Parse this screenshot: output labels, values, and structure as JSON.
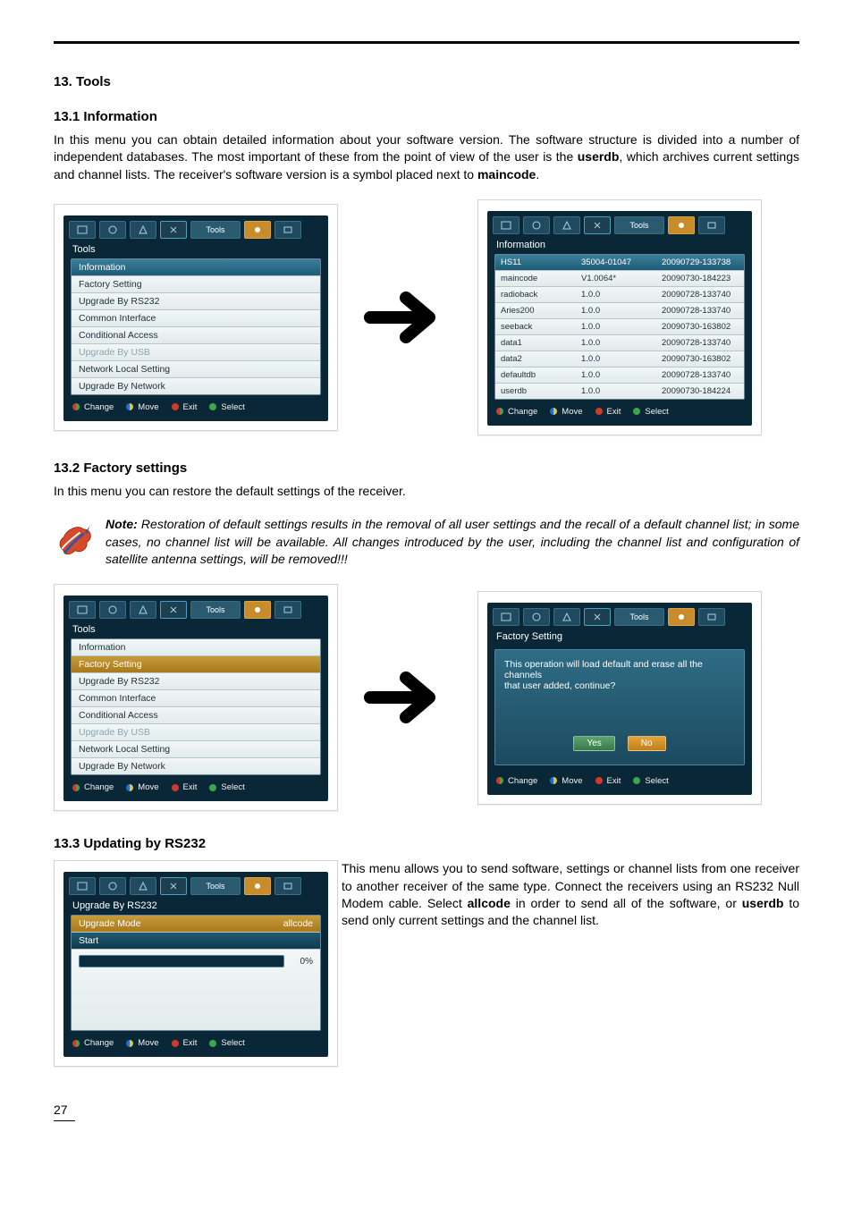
{
  "page_number": "27",
  "heading_tools": "13. Tools",
  "sec131": {
    "title": "13.1 Information",
    "para": "In this menu you can obtain detailed information about your software version. The software structure is divided into a number of independent databases. The most important of these from the point of view of the user is the ",
    "bold1": "userdb",
    "mid": ", which archives current settings and channel lists. The receiver's software version is a symbol placed next to ",
    "bold2": "maincode",
    "end": "."
  },
  "tools_menu_title": "Tools",
  "tabs_label": "Tools",
  "tools_items": [
    "Information",
    "Factory Setting",
    "Upgrade By RS232",
    "Common Interface",
    "Conditional Access",
    "Upgrade By USB",
    "Network Local Setting",
    "Upgrade By Network"
  ],
  "footer": {
    "change": "Change",
    "move": "Move",
    "exit": "Exit",
    "select": "Select"
  },
  "info_title": "Information",
  "info_rows": [
    {
      "k": "HS11",
      "v1": "35004-01047",
      "v2": "20090729-133738"
    },
    {
      "k": "maincode",
      "v1": "V1.0064*",
      "v2": "20090730-184223"
    },
    {
      "k": "radioback",
      "v1": "1.0.0",
      "v2": "20090728-133740"
    },
    {
      "k": "Aries200",
      "v1": "1.0.0",
      "v2": "20090728-133740"
    },
    {
      "k": "seeback",
      "v1": "1.0.0",
      "v2": "20090730-163802"
    },
    {
      "k": "data1",
      "v1": "1.0.0",
      "v2": "20090728-133740"
    },
    {
      "k": "data2",
      "v1": "1.0.0",
      "v2": "20090730-163802"
    },
    {
      "k": "defaultdb",
      "v1": "1.0.0",
      "v2": "20090728-133740"
    },
    {
      "k": "userdb",
      "v1": "1.0.0",
      "v2": "20090730-184224"
    }
  ],
  "sec132": {
    "title": "13.2 Factory settings",
    "para": "In this menu you can restore the default settings of the receiver.",
    "note_label": "Note:",
    "note": " Restoration of default settings results in the removal of all user settings and the recall of a default channel list; in some cases, no channel list will be available. All changes introduced by the user, including the channel list and configuration of satellite antenna settings, will be removed!!!"
  },
  "factory_title": "Factory Setting",
  "dialog": {
    "line1": "This operation will load default and erase all the channels",
    "line2": "that user added, continue?",
    "yes": "Yes",
    "no": "No"
  },
  "sec133": {
    "title": "13.3 Updating by RS232",
    "para1": "This menu allows you to send software, settings or channel lists from one receiver to another receiver of the same type. Connect the receivers using an RS232 Null Modem cable. Select ",
    "b1": "allcode",
    "mid1": " in order to send all of the software, or ",
    "b2": "userdb",
    "end1": " to send only current settings and the channel list."
  },
  "rs232": {
    "title": "Upgrade By RS232",
    "mode_label": "Upgrade Mode",
    "mode_value": "allcode",
    "start": "Start",
    "progress": "0%"
  }
}
